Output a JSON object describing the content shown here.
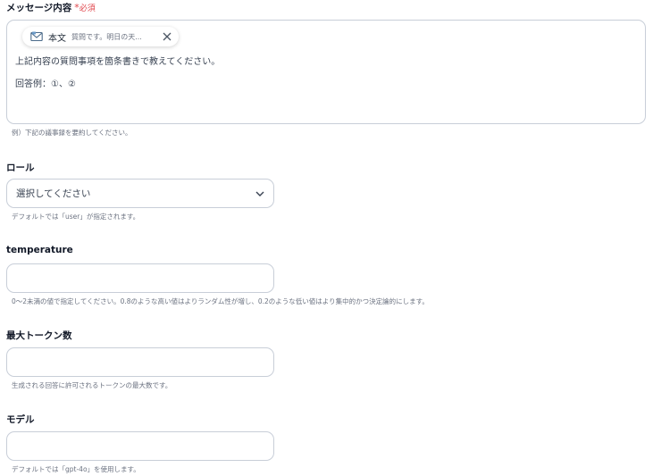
{
  "message": {
    "label": "メッセージ内容",
    "required_mark": "*",
    "required_text": "必須",
    "chip": {
      "name": "本文",
      "preview": "質問です。明日の天...",
      "icon": "mail-icon",
      "close_icon": "close-icon"
    },
    "lines": [
      "上記内容の質問事項を箇条書きで教えてください。",
      "回答例：①、②"
    ],
    "help": "例）下記の議事録を要約してください。"
  },
  "role": {
    "label": "ロール",
    "placeholder": "選択してください",
    "help": "デフォルトでは「user」が指定されます。"
  },
  "temperature": {
    "label": "temperature",
    "value": "",
    "help": "0〜2未満の値で指定してください。0.8のような高い値はよりランダム性が増し、0.2のような低い値はより集中的かつ決定論的にします。"
  },
  "max_tokens": {
    "label": "最大トークン数",
    "value": "",
    "help": "生成される回答に許可されるトークンの最大数です。"
  },
  "model": {
    "label": "モデル",
    "value": "",
    "help": "デフォルトでは「gpt-4o」を使用します。"
  }
}
